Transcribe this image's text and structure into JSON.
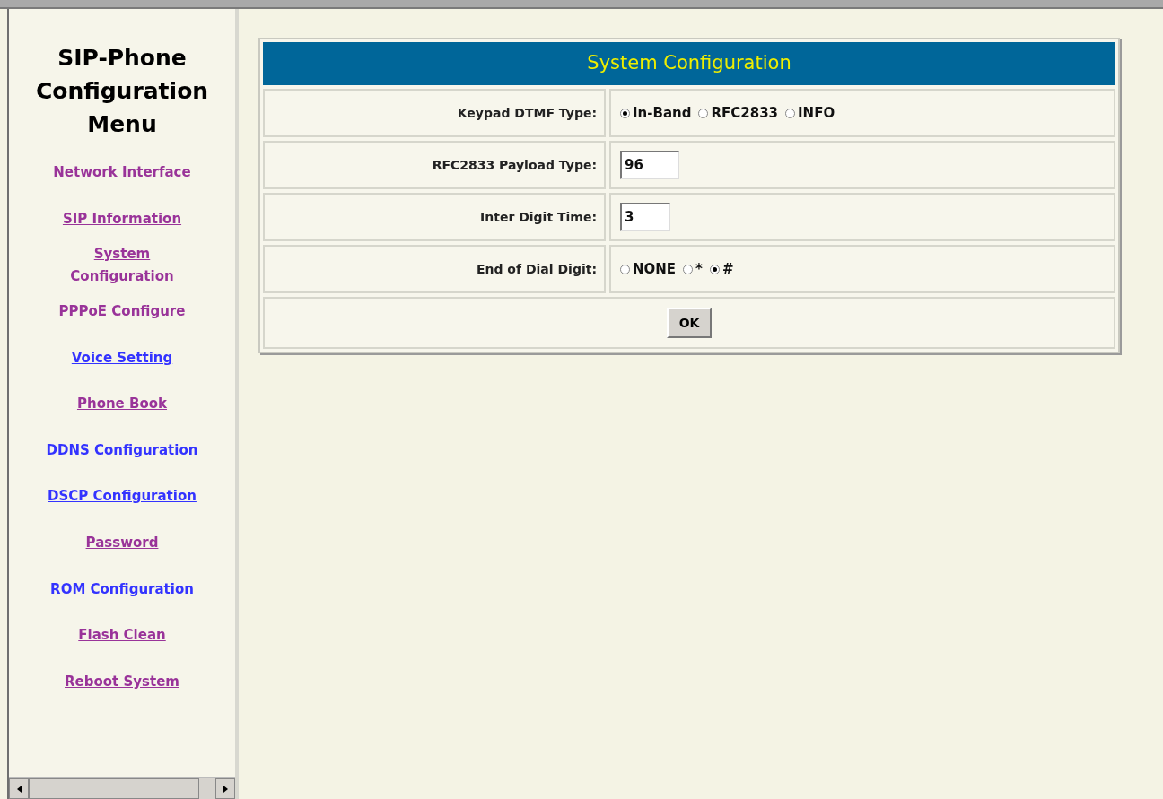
{
  "menu": {
    "title": "SIP-Phone Configuration Menu",
    "items": [
      {
        "label": "Network Interface",
        "visited": true
      },
      {
        "label": "SIP Information",
        "visited": true
      },
      {
        "label": "System Configuration",
        "visited": true
      },
      {
        "label": "PPPoE Configure",
        "visited": true
      },
      {
        "label": "Voice Setting",
        "visited": false
      },
      {
        "label": "Phone Book",
        "visited": true
      },
      {
        "label": "DDNS Configuration",
        "visited": false
      },
      {
        "label": "DSCP Configuration",
        "visited": false
      },
      {
        "label": "Password",
        "visited": true
      },
      {
        "label": "ROM Configuration",
        "visited": false
      },
      {
        "label": "Flash Clean",
        "visited": true
      },
      {
        "label": "Reboot System",
        "visited": true
      }
    ]
  },
  "form": {
    "title": "System Configuration",
    "rows": [
      {
        "kind": "radio",
        "label": "Keypad DTMF Type:",
        "options": [
          {
            "label": "In-Band",
            "selected": true
          },
          {
            "label": "RFC2833",
            "selected": false
          },
          {
            "label": "INFO",
            "selected": false
          }
        ]
      },
      {
        "kind": "text",
        "label": "RFC2833 Payload Type:",
        "value": "96"
      },
      {
        "kind": "text",
        "label": "Inter Digit Time:",
        "value": "3"
      },
      {
        "kind": "radio",
        "label": "End of Dial Digit:",
        "options": [
          {
            "label": "NONE",
            "selected": false
          },
          {
            "label": "*",
            "selected": false
          },
          {
            "label": "#",
            "selected": true
          }
        ]
      }
    ],
    "button": "OK"
  }
}
